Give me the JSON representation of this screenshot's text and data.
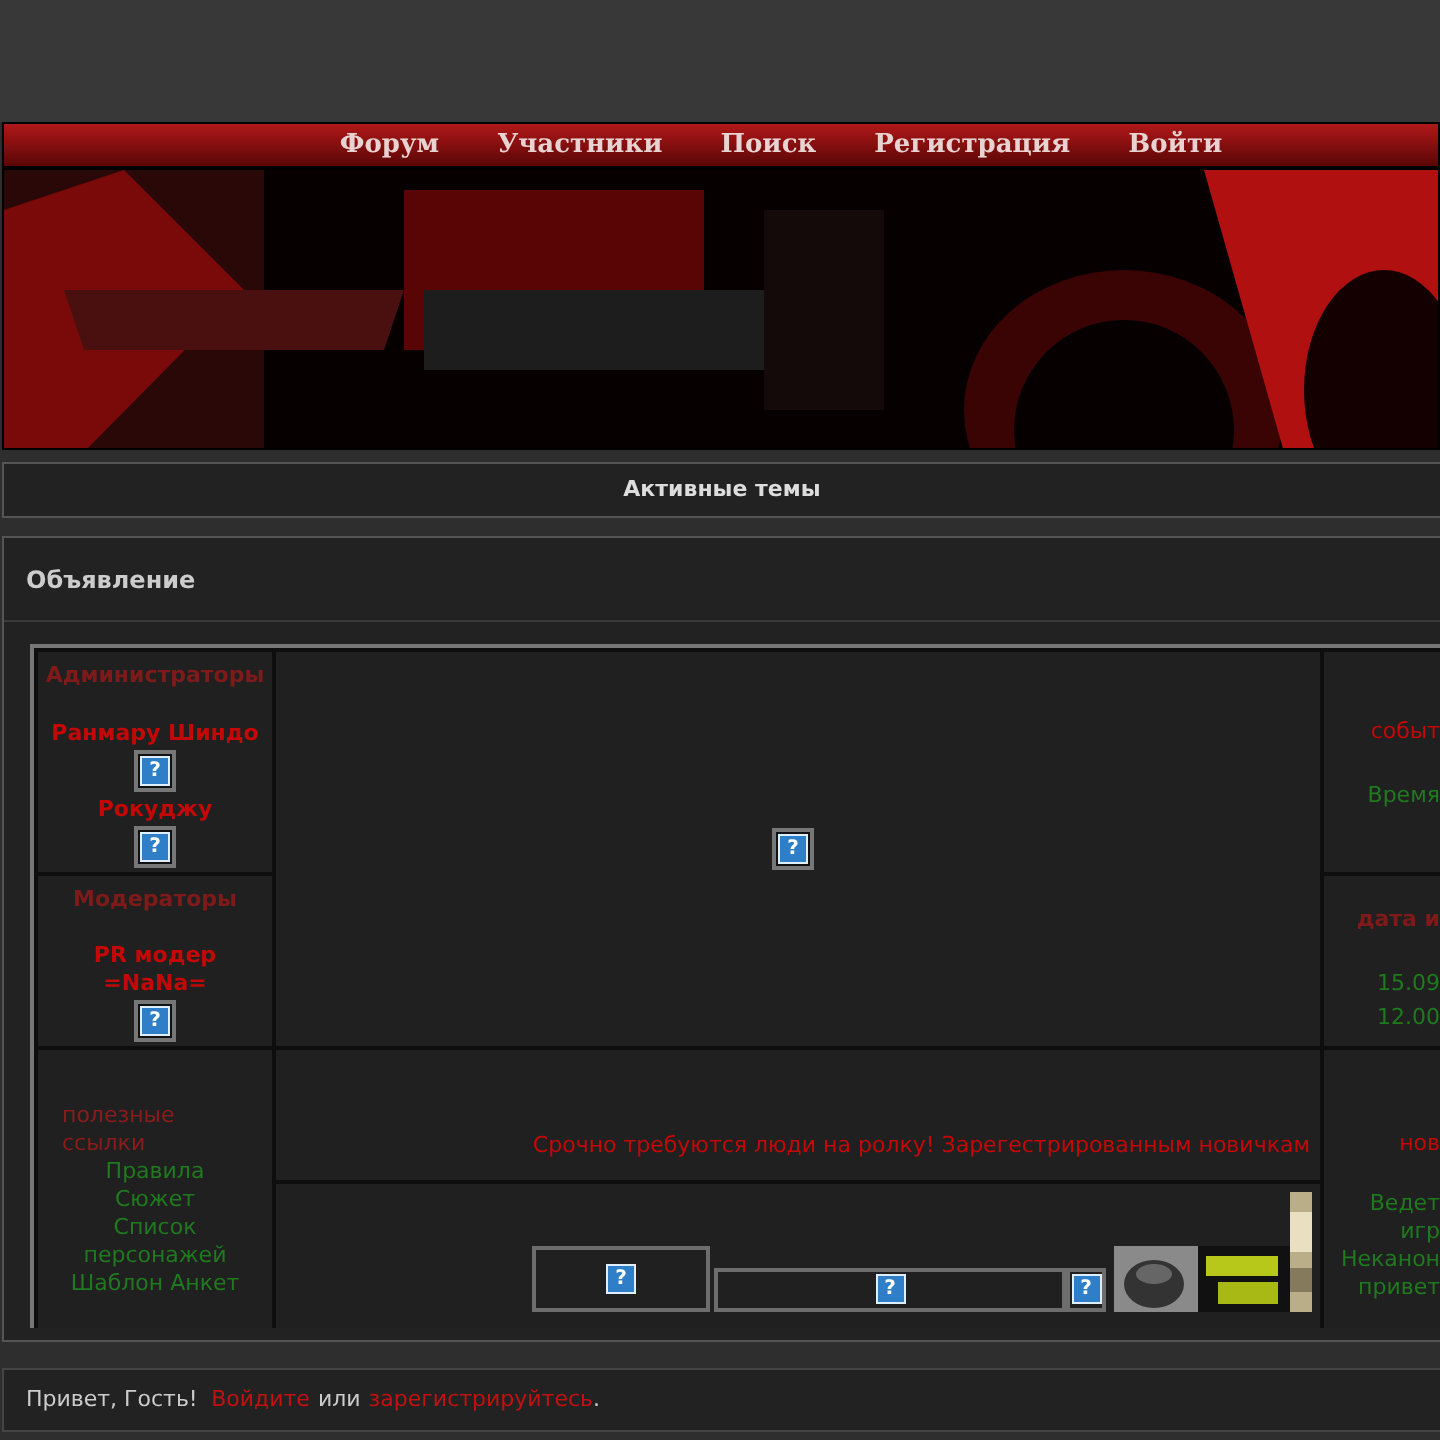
{
  "nav": [
    {
      "label": "Форум"
    },
    {
      "label": "Участники"
    },
    {
      "label": "Поиск"
    },
    {
      "label": "Регистрация"
    },
    {
      "label": "Войти"
    }
  ],
  "active_topics": {
    "label": "Активные темы"
  },
  "announcement": {
    "title": "Объявление",
    "staff": [
      {
        "heading": "Администраторы",
        "members": [
          {
            "lines": [
              "Ранмару Шиндо"
            ],
            "glyph": "?"
          },
          {
            "lines": [
              "Рокуджу"
            ],
            "glyph": "?"
          }
        ]
      },
      {
        "heading": "Модераторы",
        "members": [
          {
            "lines": [
              "PR модер",
              "=NaNa="
            ],
            "glyph": "?"
          }
        ]
      }
    ],
    "center_image": {
      "glyph": "?"
    },
    "right_top": {
      "heading": "событ",
      "lines": [
        "Время"
      ]
    },
    "right_mid": {
      "heading": "дата и",
      "lines": [
        "15.09",
        "12.00"
      ]
    },
    "links": {
      "heading": "полезные ссылки",
      "items": [
        "Правила",
        "Сюжет",
        "Список персонажей",
        "Шаблон Анкет"
      ]
    },
    "notice": "Срочно требуются люди на ролку! Зарегестрированным новичкам",
    "buttons": [
      {
        "glyph": "?"
      },
      {
        "glyph": "?"
      },
      {
        "glyph": "?"
      }
    ],
    "right_bottom": {
      "heading": "нов",
      "lines": [
        "Ведет",
        "игр",
        "Неканон",
        "привет"
      ]
    }
  },
  "footer": {
    "greeting": "Привет, Гость!",
    "login": "Войдите",
    "or": "или",
    "register": "зарегистрируйтесь",
    "end": "."
  }
}
